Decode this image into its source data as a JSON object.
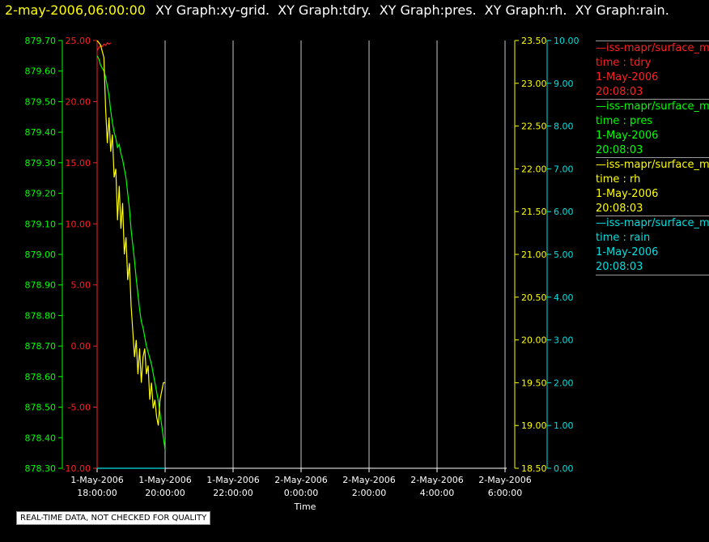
{
  "header": {
    "date": "2-may-2006,06:00:00",
    "graphs": [
      "XY Graph:xy-grid.",
      "XY Graph:tdry.",
      "XY Graph:pres.",
      "XY Graph:rh.",
      "XY Graph:rain."
    ]
  },
  "quality_note": "REAL-TIME DATA, NOT CHECKED FOR QUALITY",
  "legend": [
    {
      "source": "—iss-mapr/surface_m",
      "line1": "time : tdry",
      "line2": "1-May-2006",
      "line3": "20:08:03",
      "color": "#ff2020"
    },
    {
      "source": "—iss-mapr/surface_m",
      "line1": "time : pres",
      "line2": "1-May-2006",
      "line3": "20:08:03",
      "color": "#00ff00"
    },
    {
      "source": "—iss-mapr/surface_m",
      "line1": "time : rh",
      "line2": "1-May-2006",
      "line3": "20:08:03",
      "color": "#ffff00"
    },
    {
      "source": "—iss-mapr/surface_m",
      "line1": "time : rain",
      "line2": "1-May-2006",
      "line3": "20:08:03",
      "color": "#00e0e0"
    }
  ],
  "chart_data": {
    "type": "line",
    "xlabel": "Time",
    "x_ticks": [
      {
        "l1": "1-May-2006",
        "l2": "18:00:00",
        "hours": 0
      },
      {
        "l1": "1-May-2006",
        "l2": "20:00:00",
        "hours": 2
      },
      {
        "l1": "1-May-2006",
        "l2": "22:00:00",
        "hours": 4
      },
      {
        "l1": "2-May-2006",
        "l2": "0:00:00",
        "hours": 6
      },
      {
        "l1": "2-May-2006",
        "l2": "2:00:00",
        "hours": 8
      },
      {
        "l1": "2-May-2006",
        "l2": "4:00:00",
        "hours": 10
      },
      {
        "l1": "2-May-2006",
        "l2": "6:00:00",
        "hours": 12
      }
    ],
    "grid": true,
    "axes": [
      {
        "name": "tdry",
        "side": "left",
        "color": "#ff2020",
        "range": [
          -10,
          25
        ],
        "ticks": [
          "25.00",
          "20.00",
          "15.00",
          "10.00",
          "5.00",
          "0.00",
          "-5.00",
          "-10.00"
        ],
        "tick_values": [
          25,
          20,
          15,
          10,
          5,
          0,
          -5,
          -10
        ]
      },
      {
        "name": "pres",
        "side": "left",
        "color": "#00ff00",
        "range": [
          878.3,
          879.7
        ],
        "ticks": [
          "879.70",
          "879.60",
          "879.50",
          "879.40",
          "879.30",
          "879.20",
          "879.10",
          "879.00",
          "878.90",
          "878.80",
          "878.70",
          "878.60",
          "878.50",
          "878.40",
          "878.30"
        ],
        "tick_values": [
          879.7,
          879.6,
          879.5,
          879.4,
          879.3,
          879.2,
          879.1,
          879.0,
          878.9,
          878.8,
          878.7,
          878.6,
          878.5,
          878.4,
          878.3
        ]
      },
      {
        "name": "rh",
        "side": "right",
        "color": "#ffff00",
        "range": [
          18.5,
          23.5
        ],
        "ticks": [
          "23.50",
          "23.00",
          "22.50",
          "22.00",
          "21.50",
          "21.00",
          "20.50",
          "20.00",
          "19.50",
          "19.00",
          "18.50"
        ],
        "tick_values": [
          23.5,
          23.0,
          22.5,
          22.0,
          21.5,
          21.0,
          20.5,
          20.0,
          19.5,
          19.0,
          18.5
        ]
      },
      {
        "name": "rain",
        "side": "right",
        "color": "#00e0e0",
        "range": [
          0,
          10
        ],
        "ticks": [
          "10.00",
          "9.00",
          "8.00",
          "7.00",
          "6.00",
          "5.00",
          "4.00",
          "3.00",
          "2.00",
          "1.00",
          "0.00"
        ],
        "tick_values": [
          10,
          9,
          8,
          7,
          6,
          5,
          4,
          3,
          2,
          1,
          0
        ]
      }
    ],
    "series": [
      {
        "name": "tdry",
        "color": "#ff2020",
        "axis": 0,
        "x": [
          0.0,
          0.05,
          0.1,
          0.15,
          0.2,
          0.25,
          0.3,
          0.35,
          0.4
        ],
        "y": [
          24.2,
          24.4,
          24.6,
          24.5,
          24.7,
          24.6,
          24.8,
          24.7,
          24.8
        ]
      },
      {
        "name": "pres",
        "color": "#00ff00",
        "axis": 1,
        "x": [
          0.0,
          0.05,
          0.1,
          0.15,
          0.2,
          0.25,
          0.3,
          0.35,
          0.4,
          0.45,
          0.5,
          0.55,
          0.6,
          0.65,
          0.7,
          0.75,
          0.8,
          0.85,
          0.9,
          0.95,
          1.0,
          1.05,
          1.1,
          1.15,
          1.2,
          1.25,
          1.3,
          1.35,
          1.4,
          1.45,
          1.5,
          1.55,
          1.6,
          1.65,
          1.7,
          1.75,
          1.8,
          1.85,
          1.9,
          1.95,
          2.0
        ],
        "y": [
          879.65,
          879.64,
          879.62,
          879.61,
          879.6,
          879.58,
          879.55,
          879.52,
          879.47,
          879.43,
          879.4,
          879.38,
          879.35,
          879.36,
          879.33,
          879.31,
          879.28,
          879.25,
          879.2,
          879.15,
          879.08,
          879.03,
          878.98,
          878.92,
          878.87,
          878.82,
          878.78,
          878.76,
          878.73,
          878.7,
          878.68,
          878.66,
          878.64,
          878.61,
          878.58,
          878.55,
          878.52,
          878.48,
          878.44,
          878.4,
          878.36
        ]
      },
      {
        "name": "rh",
        "color": "#ffff00",
        "axis": 2,
        "x": [
          0.0,
          0.1,
          0.2,
          0.25,
          0.3,
          0.35,
          0.4,
          0.45,
          0.5,
          0.55,
          0.6,
          0.65,
          0.7,
          0.75,
          0.8,
          0.85,
          0.9,
          0.95,
          1.0,
          1.05,
          1.1,
          1.15,
          1.2,
          1.25,
          1.3,
          1.35,
          1.4,
          1.45,
          1.5,
          1.55,
          1.6,
          1.65,
          1.7,
          1.75,
          1.8,
          1.85,
          1.9,
          1.95,
          2.0
        ],
        "y": [
          23.5,
          23.45,
          23.3,
          22.7,
          22.3,
          22.6,
          22.2,
          22.4,
          21.9,
          22.0,
          21.4,
          21.8,
          21.3,
          21.6,
          21.0,
          21.2,
          20.7,
          20.9,
          20.4,
          20.1,
          19.8,
          20.0,
          19.6,
          19.9,
          19.5,
          19.8,
          19.9,
          19.6,
          19.7,
          19.3,
          19.5,
          19.2,
          19.3,
          19.1,
          19.0,
          19.3,
          19.4,
          19.5,
          19.5
        ]
      },
      {
        "name": "rain",
        "color": "#00e0e0",
        "axis": 3,
        "x": [
          0.0,
          2.0
        ],
        "y": [
          0.0,
          0.0
        ]
      }
    ]
  }
}
